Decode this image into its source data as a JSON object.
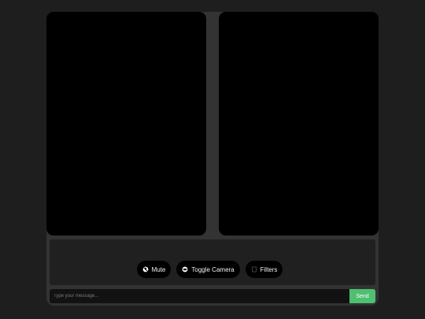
{
  "controls": {
    "mute_label": "Mute",
    "toggle_camera_label": "Toggle Camera",
    "filters_label": "Filters"
  },
  "chat": {
    "placeholder": "Type your message...",
    "send_label": "Send"
  },
  "icons": {
    "mute": "microphone-off-icon",
    "camera": "camera-icon",
    "filters": "filters-icon"
  },
  "colors": {
    "background": "#1e1e1e",
    "panel": "#333333",
    "video": "#000000",
    "send_button": "#4fbf72"
  }
}
